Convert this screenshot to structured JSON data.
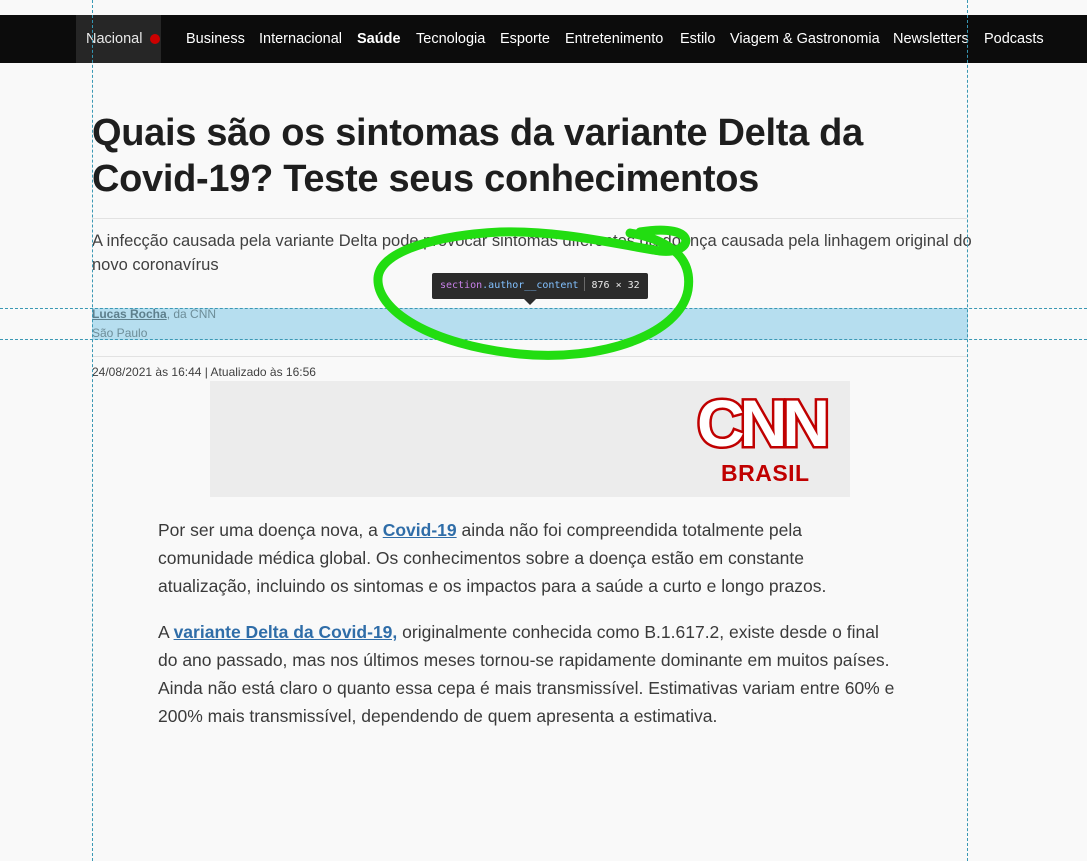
{
  "nav": {
    "items": [
      {
        "label": "Nacional"
      },
      {
        "label": "Business"
      },
      {
        "label": "Internacional"
      },
      {
        "label": "Saúde"
      },
      {
        "label": "Tecnologia"
      },
      {
        "label": "Esporte"
      },
      {
        "label": "Entretenimento"
      },
      {
        "label": "Estilo"
      },
      {
        "label": "Viagem & Gastronomia"
      },
      {
        "label": "Newsletters"
      },
      {
        "label": "Podcasts"
      }
    ]
  },
  "article": {
    "headline": "Quais são os sintomas da variante Delta da Covid-19? Teste seus conhecimentos",
    "summary": "A infecção causada pela variante Delta pode provocar sintomas diferentes da doença causada pela linhagem original do novo coronavírus",
    "author": {
      "name": "Lucas Rocha",
      "outlet": ", da CNN",
      "location": "São Paulo"
    },
    "dateline": "24/08/2021 às 16:44 | Atualizado às 16:56",
    "logo": {
      "main": "CNN",
      "sub": "BRASIL"
    },
    "paragraphs": [
      {
        "before": "Por ser uma doença nova, a ",
        "link": "Covid-19",
        "after": " ainda não foi compreendida totalmente pela comunidade médica global. Os conhecimentos sobre a doença estão em constante atualização, incluindo os sintomas e os impactos para a saúde a curto e longo prazos."
      },
      {
        "before": "A ",
        "link": "variante Delta da Covid-19,",
        "after": " originalmente conhecida como B.1.617.2, existe desde o final do ano passado, mas nos últimos meses tornou-se rapidamente dominante em muitos países. Ainda não está claro o quanto essa cepa é mais transmissível. Estimativas variam entre 60% e 200% mais transmissível, dependendo de quem apresenta a estimativa."
      }
    ]
  },
  "devtools_tooltip": {
    "tag": "section",
    "class_name": ".author__content",
    "size": "876 × 32"
  },
  "colors": {
    "nav_bg": "#0c0c0c",
    "brand_red": "#c00000",
    "link": "#2f6da8",
    "highlight": "#b6deef",
    "annotation": "#22dd11"
  },
  "icons": {
    "live": "red-dot-icon"
  }
}
